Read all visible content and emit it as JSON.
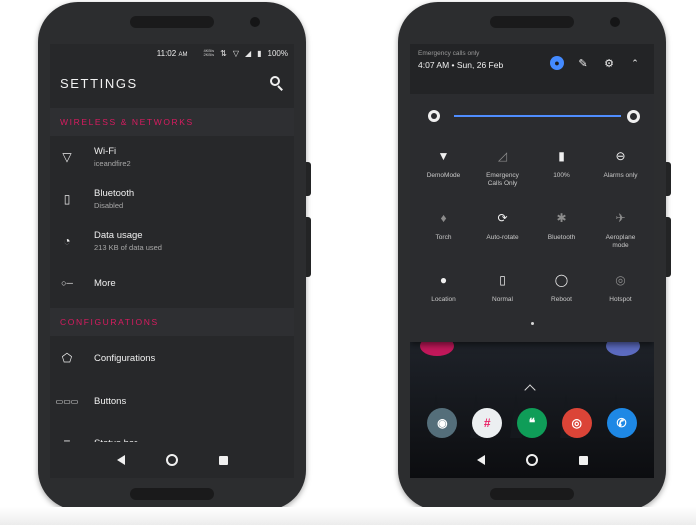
{
  "left_phone": {
    "status": {
      "time": "11:02",
      "ampm": "AM",
      "net_speed_top": "4KB/s",
      "net_speed_bottom": "2KB/s",
      "battery_pct": "100%"
    },
    "appbar": {
      "title": "SETTINGS",
      "search_icon": "search-icon"
    },
    "sections": [
      {
        "header": "WIRELESS & NETWORKS",
        "items": [
          {
            "title": "Wi-Fi",
            "summary": "iceandfire2",
            "icon": "wifi-icon"
          },
          {
            "title": "Bluetooth",
            "summary": "Disabled",
            "icon": "bluetooth-icon"
          },
          {
            "title": "Data usage",
            "summary": "213 KB of data used",
            "icon": "data-usage-icon"
          },
          {
            "title": "More",
            "summary": "",
            "icon": "more-icon"
          }
        ]
      },
      {
        "header": "CONFIGURATIONS",
        "items": [
          {
            "title": "Configurations",
            "icon": "configurations-icon"
          },
          {
            "title": "Buttons",
            "icon": "buttons-icon"
          },
          {
            "title": "Status bar",
            "icon": "statusbar-icon"
          }
        ]
      }
    ]
  },
  "right_phone": {
    "header": {
      "emergency_text": "Emergency calls only",
      "datetime": "4:07 AM  •  Sun, 26 Feb"
    },
    "brightness_level": 1.0,
    "tiles": [
      {
        "label": "DemoMode",
        "icon": "wifi-icon",
        "active": true
      },
      {
        "label": "Emergency Calls Only",
        "icon": "signal-off-icon",
        "active": false
      },
      {
        "label": "100%",
        "icon": "battery-icon",
        "active": true
      },
      {
        "label": "Alarms only",
        "icon": "dnd-icon",
        "active": true
      },
      {
        "label": "Torch",
        "icon": "torch-icon",
        "active": false
      },
      {
        "label": "Auto-rotate",
        "icon": "rotate-icon",
        "active": true
      },
      {
        "label": "Bluetooth",
        "icon": "bluetooth-icon",
        "active": false
      },
      {
        "label": "Aeroplane mode",
        "icon": "airplane-icon",
        "active": false
      },
      {
        "label": "Location",
        "icon": "location-icon",
        "active": true
      },
      {
        "label": "Normal",
        "icon": "phone-icon",
        "active": true
      },
      {
        "label": "Reboot",
        "icon": "power-icon",
        "active": true
      },
      {
        "label": "Hotspot",
        "icon": "hotspot-icon",
        "active": false
      }
    ]
  },
  "colors": {
    "accent": "#d81b60",
    "slider": "#4f8dff",
    "panel": "#2b2c2f",
    "screen": "#27282a"
  }
}
